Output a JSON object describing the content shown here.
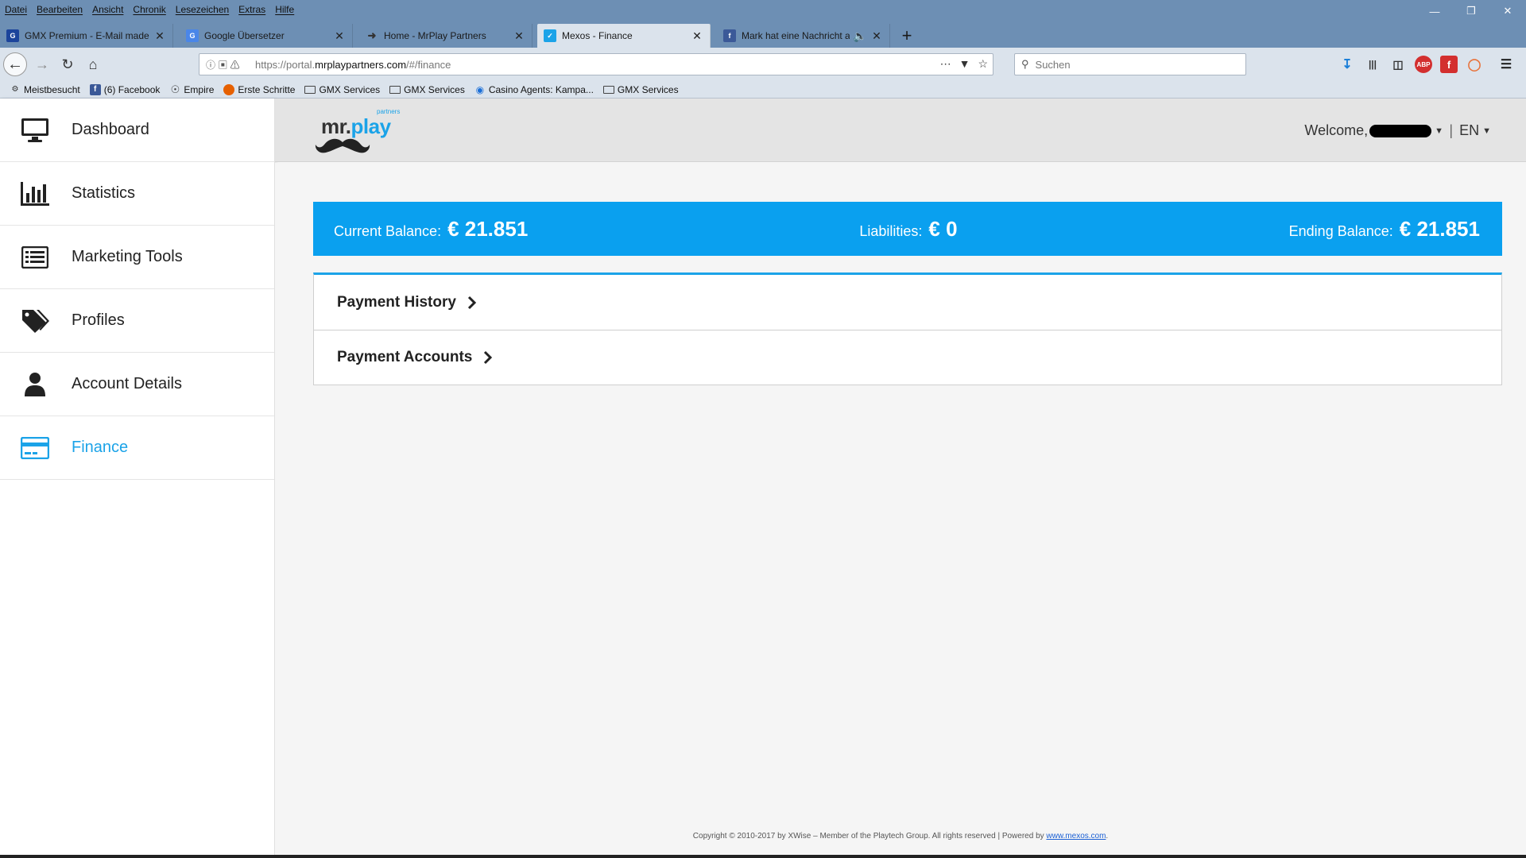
{
  "browser": {
    "menu": [
      "Datei",
      "Bearbeiten",
      "Ansicht",
      "Chronik",
      "Lesezeichen",
      "Extras",
      "Hilfe"
    ],
    "tabs": [
      {
        "title": "GMX Premium - E-Mail made i",
        "favicon": "gmx-icon",
        "favicon_color": "#1c449b"
      },
      {
        "title": "Google Übersetzer",
        "favicon": "google-translate-icon",
        "favicon_color": "#4a86e8"
      },
      {
        "title": "Home - MrPlay Partners",
        "favicon": "mustache-icon",
        "favicon_color": "#333333"
      },
      {
        "title": "Mexos - Finance",
        "favicon": "mexos-icon",
        "favicon_color": "#1ba3e8",
        "active": true
      },
      {
        "title": "Mark hat eine Nachricht an",
        "favicon": "facebook-icon",
        "favicon_color": "#3b5998",
        "audio": true
      }
    ],
    "url": {
      "prefix": "https://portal.",
      "domain": "mrplaypartners.com",
      "path": "/#/finance"
    },
    "search_placeholder": "Suchen",
    "bookmarks": [
      {
        "label": "Meistbesucht",
        "icon": "gear-icon"
      },
      {
        "label": "(6) Facebook",
        "icon": "facebook-icon"
      },
      {
        "label": "Empire",
        "icon": "globe-icon"
      },
      {
        "label": "Erste Schritte",
        "icon": "firefox-icon"
      },
      {
        "label": "GMX Services",
        "icon": "folder-icon"
      },
      {
        "label": "GMX Services",
        "icon": "folder-icon"
      },
      {
        "label": "Casino Agents: Kampa...",
        "icon": "casino-icon"
      },
      {
        "label": "GMX Services",
        "icon": "folder-icon"
      }
    ]
  },
  "header": {
    "logo": {
      "text_main": "mr.",
      "text_accent": "play",
      "sub": "partners"
    },
    "welcome": "Welcome,",
    "language": "EN"
  },
  "sidebar": {
    "items": [
      {
        "label": "Dashboard",
        "icon": "monitor-icon"
      },
      {
        "label": "Statistics",
        "icon": "bar-chart-icon"
      },
      {
        "label": "Marketing Tools",
        "icon": "list-icon"
      },
      {
        "label": "Profiles",
        "icon": "tags-icon"
      },
      {
        "label": "Account Details",
        "icon": "user-icon"
      },
      {
        "label": "Finance",
        "icon": "credit-card-icon",
        "active": true
      }
    ]
  },
  "finance": {
    "current_balance_label": "Current Balance:",
    "current_balance_value": "€ 21.851",
    "liabilities_label": "Liabilities:",
    "liabilities_value": "€ 0",
    "ending_balance_label": "Ending Balance:",
    "ending_balance_value": "€ 21.851",
    "sections": [
      "Payment History",
      "Payment Accounts"
    ]
  },
  "footer": {
    "text": "Copyright © 2010-2017 by XWise – Member of the Playtech Group. All rights reserved | Powered by ",
    "link": "www.mexos.com",
    "end": "."
  },
  "colors": {
    "accent": "#1ba3e8",
    "banner": "#0aa0ef",
    "browser_frame": "#6d8fb4"
  }
}
